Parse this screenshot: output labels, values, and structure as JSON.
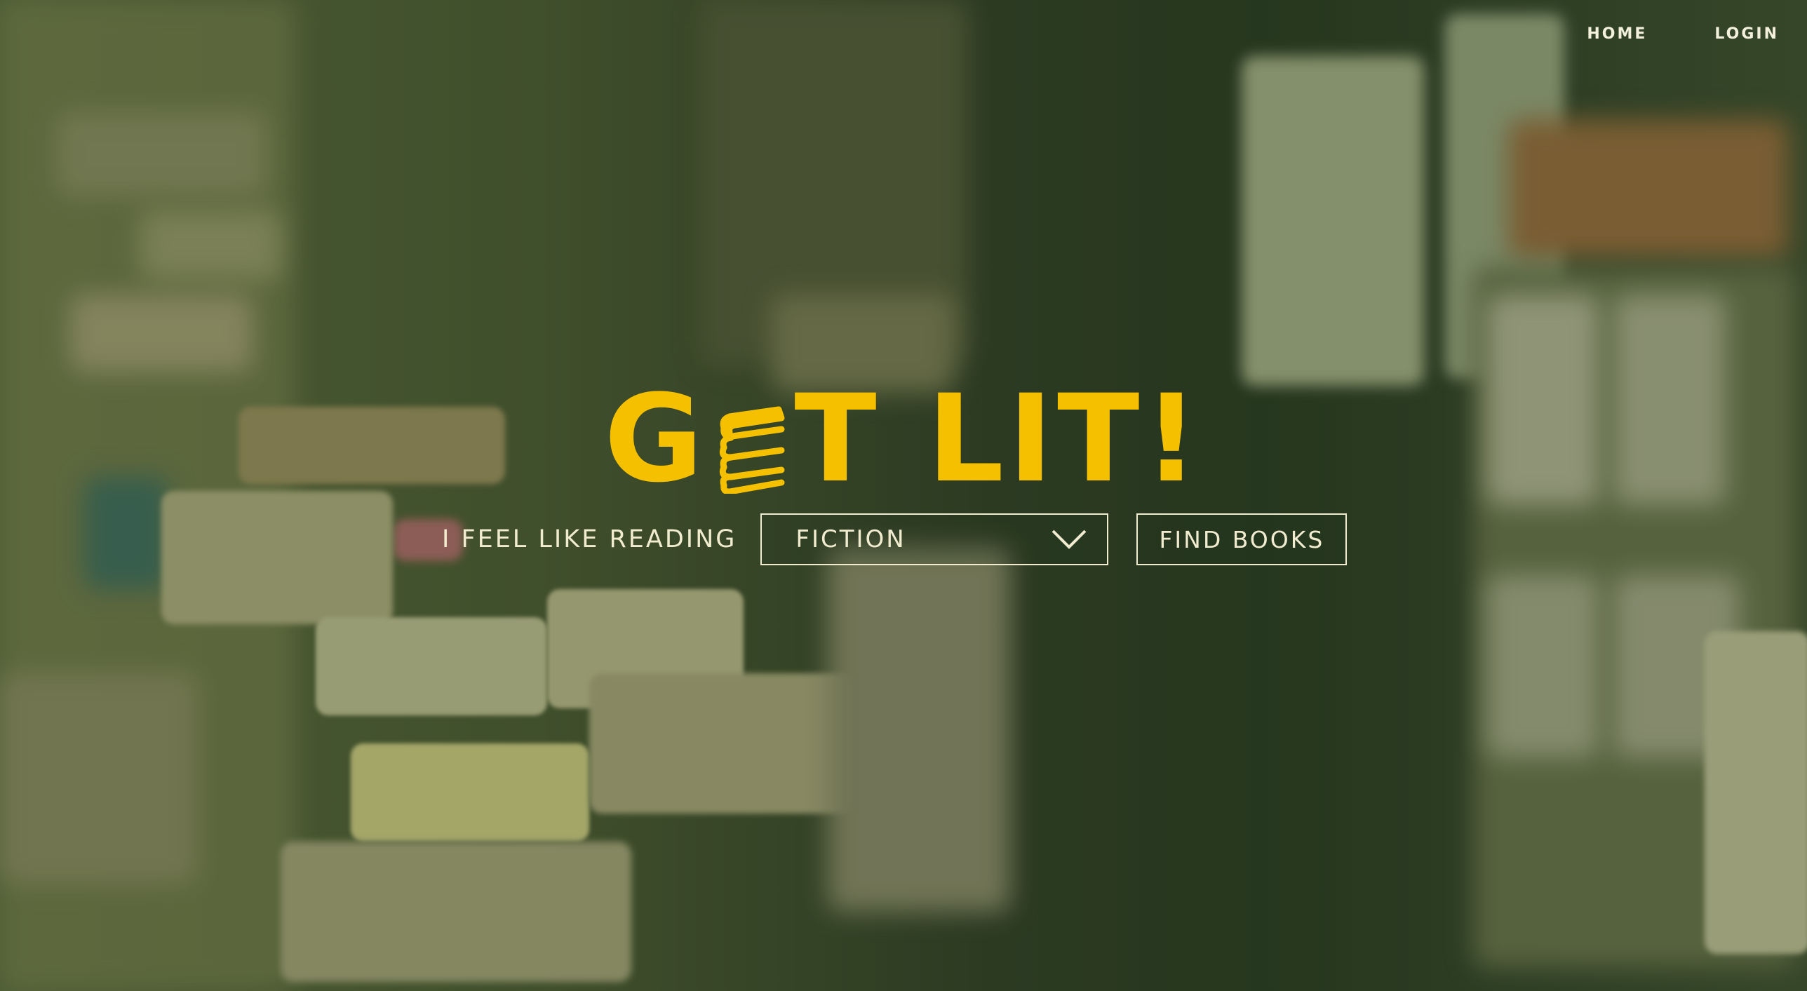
{
  "nav": {
    "items": [
      {
        "label": "HOME"
      },
      {
        "label": "LOGIN"
      }
    ]
  },
  "logo": {
    "part1": "G",
    "part2": "T LIT!",
    "icon": "stacked-books-icon",
    "color": "#f5c000"
  },
  "search": {
    "lead_text": "I FEEL LIKE READING",
    "genre_selected": "FICTION",
    "button_label": "FIND BOOKS"
  },
  "colors": {
    "accent": "#f5c000",
    "text_light": "#f1ecd0",
    "overlay": "#2e3a24"
  }
}
